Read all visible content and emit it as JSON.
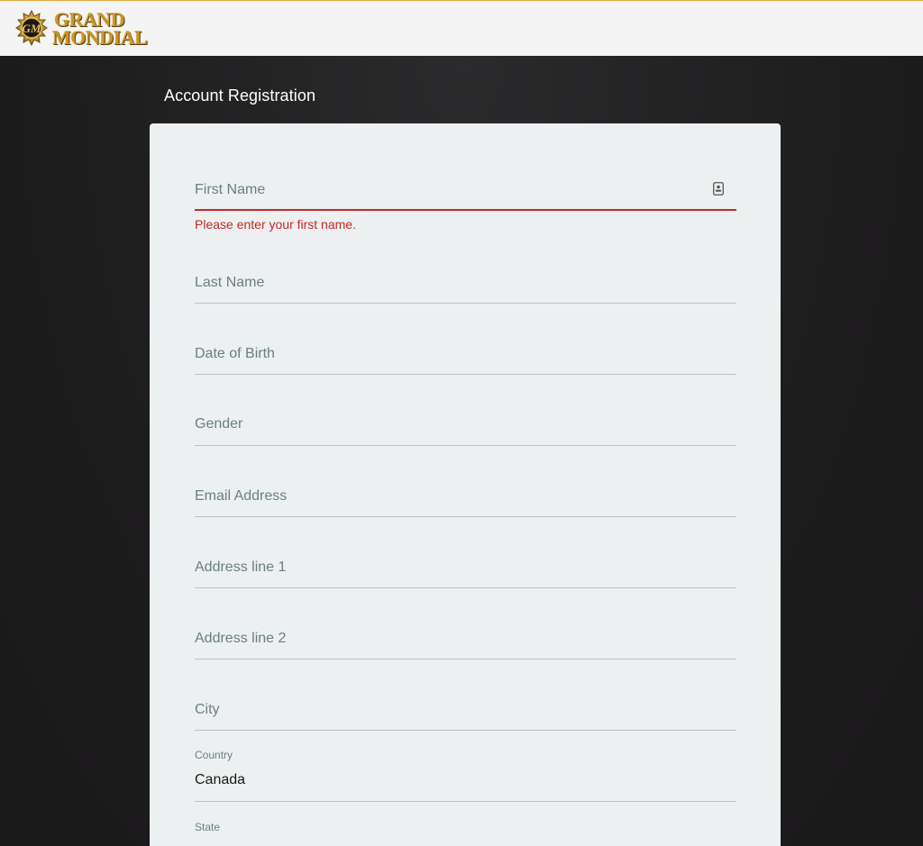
{
  "brand": {
    "line1": "GRAND",
    "line2": "MONDIAL",
    "accent": "#c8962b"
  },
  "page": {
    "title": "Account Registration"
  },
  "form": {
    "first_name": {
      "placeholder": "First Name",
      "error": "Please enter your first name.",
      "icon": "contact-card-icon"
    },
    "last_name": {
      "placeholder": "Last Name"
    },
    "dob": {
      "placeholder": "Date of Birth"
    },
    "gender": {
      "placeholder": "Gender"
    },
    "email": {
      "placeholder": "Email Address"
    },
    "address1": {
      "placeholder": "Address line 1"
    },
    "address2": {
      "placeholder": "Address line 2"
    },
    "city": {
      "placeholder": "City"
    },
    "country": {
      "label": "Country",
      "value": "Canada"
    },
    "state": {
      "label": "State"
    }
  },
  "colors": {
    "error": "#c62828",
    "card": "#ecf0f0",
    "background": "#1c1b1c"
  }
}
